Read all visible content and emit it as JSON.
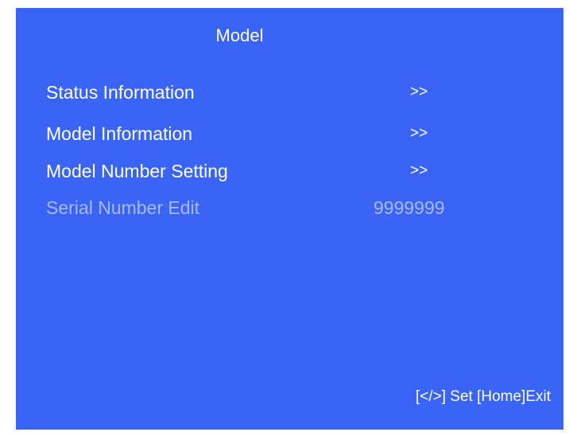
{
  "menu": {
    "title": "Model",
    "items": [
      {
        "label": "Status Information",
        "value": ">>"
      },
      {
        "label": "Model Information",
        "value": ">>"
      },
      {
        "label": "Model Number Setting",
        "value": ">>"
      },
      {
        "label": "Serial Number Edit",
        "value": "9999999"
      }
    ]
  },
  "footer": {
    "hint": "[</>] Set [Home]Exit"
  },
  "colors": {
    "background": "#3a64f5",
    "text": "#ffffff",
    "disabled_text": "#a9b8f6"
  }
}
